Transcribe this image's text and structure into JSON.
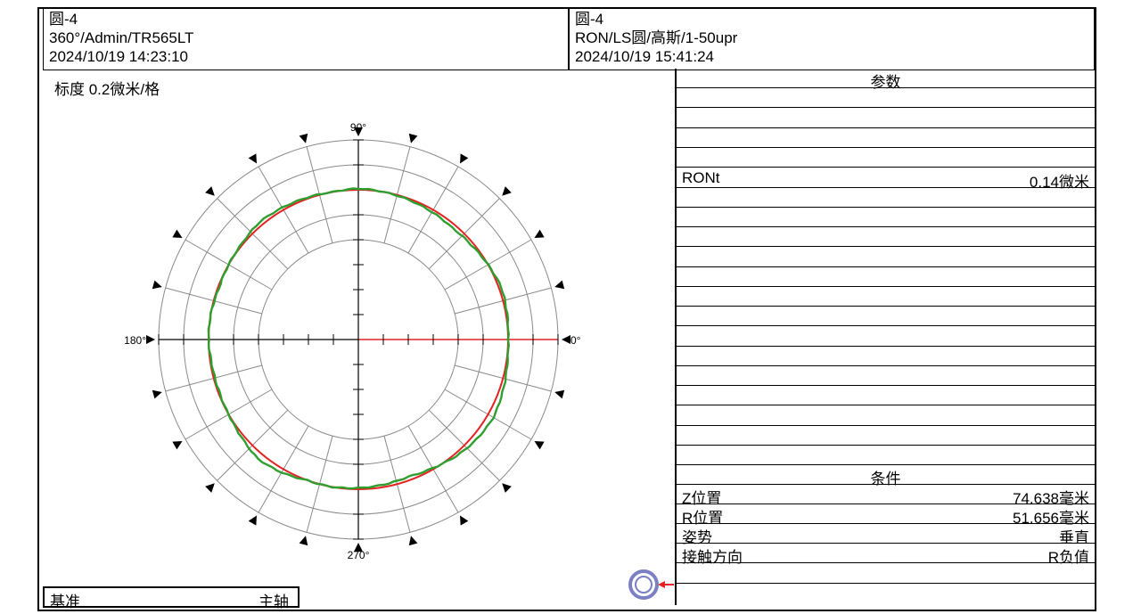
{
  "header_left": {
    "title": "圆-4",
    "info": "360°/Admin/TR565LT",
    "datetime": "2024/10/19 14:23:10"
  },
  "header_right": {
    "title": "圆-4",
    "info": "RON/LS圆/高斯/1-50upr",
    "datetime": "2024/10/19 15:41:24"
  },
  "scale_label": "标度 0.2微米/格",
  "reference": {
    "label": "基准",
    "value": "主轴"
  },
  "params": {
    "title": "参数",
    "ront_label": "RONt",
    "ront_value": "0.14微米"
  },
  "conditions": {
    "title": "条件",
    "z_label": "Z位置",
    "z_value": "74.638毫米",
    "r_label": "R位置",
    "r_value": "51.656毫米",
    "posture_label": "姿势",
    "posture_value": "垂直",
    "contact_label": "接触方向",
    "contact_value": "R负值"
  },
  "colors": {
    "profile": "#2e9e2e",
    "reference_circle": "#e32222",
    "grid": "#8a8a8a",
    "probe_ring": "#7b7fc4",
    "probe_arrow": "#e32222"
  },
  "chart_data": {
    "type": "polar",
    "title": "",
    "scale_per_division_um": 0.2,
    "angle_labels": [
      "0°",
      "90°",
      "180°",
      "270°"
    ],
    "reference_circle_radius_div": 6,
    "divisions_per_radius": 8,
    "profile_deviation_um": [
      {
        "angle": 0,
        "dev": 0.0
      },
      {
        "angle": 10,
        "dev": 0.01
      },
      {
        "angle": 20,
        "dev": 0.02
      },
      {
        "angle": 30,
        "dev": 0.0
      },
      {
        "angle": 40,
        "dev": -0.02
      },
      {
        "angle": 50,
        "dev": -0.03
      },
      {
        "angle": 60,
        "dev": -0.02
      },
      {
        "angle": 70,
        "dev": -0.01
      },
      {
        "angle": 80,
        "dev": 0.0
      },
      {
        "angle": 90,
        "dev": 0.01
      },
      {
        "angle": 100,
        "dev": 0.0
      },
      {
        "angle": 110,
        "dev": 0.01
      },
      {
        "angle": 120,
        "dev": 0.02
      },
      {
        "angle": 130,
        "dev": 0.03
      },
      {
        "angle": 140,
        "dev": 0.01
      },
      {
        "angle": 150,
        "dev": 0.0
      },
      {
        "angle": 160,
        "dev": -0.01
      },
      {
        "angle": 170,
        "dev": 0.0
      },
      {
        "angle": 180,
        "dev": 0.0
      },
      {
        "angle": 190,
        "dev": -0.01
      },
      {
        "angle": 200,
        "dev": -0.01
      },
      {
        "angle": 210,
        "dev": 0.0
      },
      {
        "angle": 220,
        "dev": 0.02
      },
      {
        "angle": 230,
        "dev": 0.05
      },
      {
        "angle": 240,
        "dev": 0.03
      },
      {
        "angle": 250,
        "dev": 0.0
      },
      {
        "angle": 260,
        "dev": 0.0
      },
      {
        "angle": 270,
        "dev": -0.01
      },
      {
        "angle": 280,
        "dev": -0.02
      },
      {
        "angle": 290,
        "dev": -0.03
      },
      {
        "angle": 300,
        "dev": -0.01
      },
      {
        "angle": 310,
        "dev": 0.02
      },
      {
        "angle": 320,
        "dev": 0.04
      },
      {
        "angle": 330,
        "dev": 0.05
      },
      {
        "angle": 340,
        "dev": 0.03
      },
      {
        "angle": 350,
        "dev": 0.01
      }
    ]
  }
}
